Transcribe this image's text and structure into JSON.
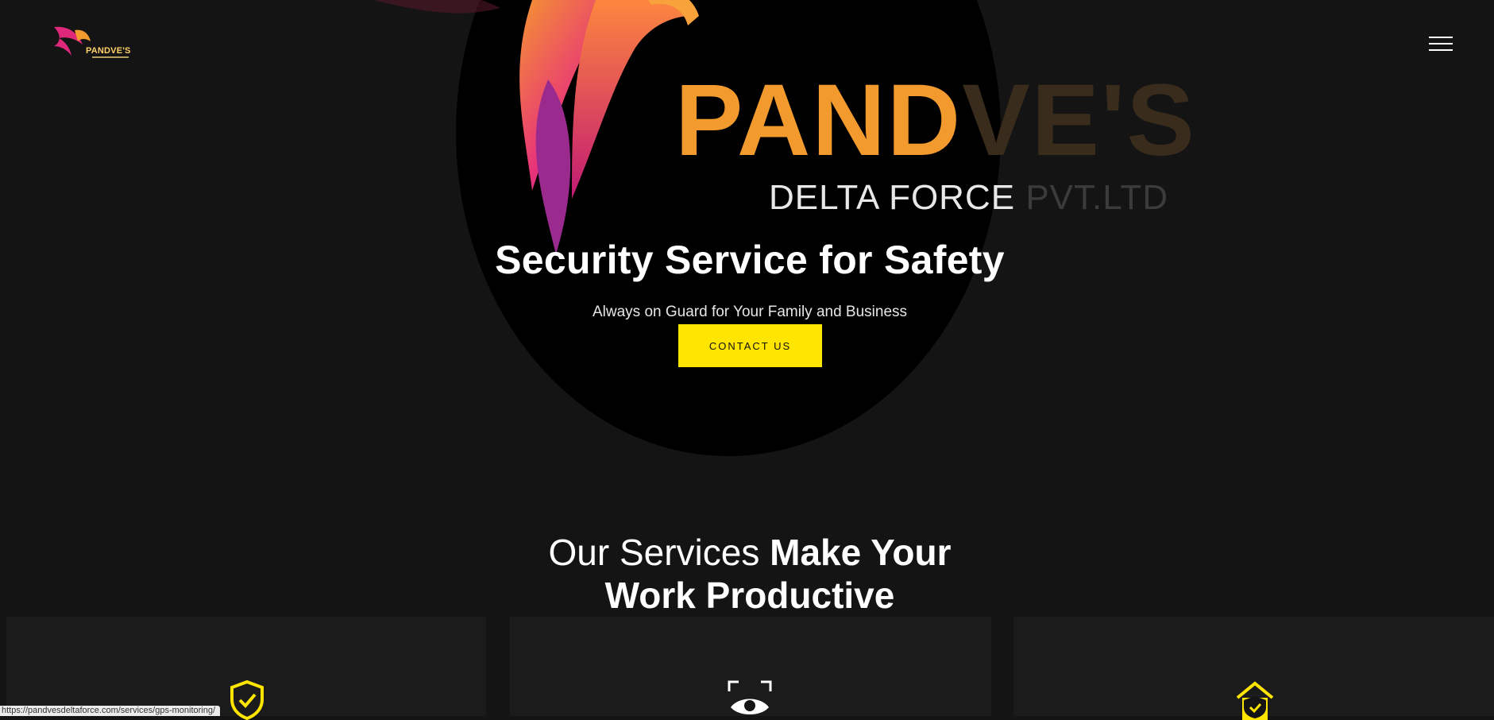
{
  "header": {
    "logo_text": "PANDVE'S",
    "menu_icon": "hamburger-menu-icon"
  },
  "hero": {
    "brand_word_1": "PAND",
    "brand_word_2": "VE'S",
    "brand_sub_1": "DELTA FORCE ",
    "brand_sub_2": "PVT.LTD",
    "title": "Security Service for Safety",
    "subtitle": "Always on Guard for Your Family and Business",
    "cta_label": "CONTACT US"
  },
  "services": {
    "title_light": "Our Services ",
    "title_bold_1": "Make Your",
    "title_bold_2": "Work Productive",
    "cards": [
      {
        "icon": "shield-check-icon"
      },
      {
        "icon": "eye-scan-icon"
      },
      {
        "icon": "home-protection-icon"
      }
    ]
  },
  "status_bar": {
    "url": "https://pandvesdeltaforce.com/services/gps-monitoring/"
  },
  "colors": {
    "background": "#141414",
    "accent_yellow": "#ffe500",
    "brand_orange": "#f29a2e",
    "brand_magenta": "#e0287a"
  }
}
